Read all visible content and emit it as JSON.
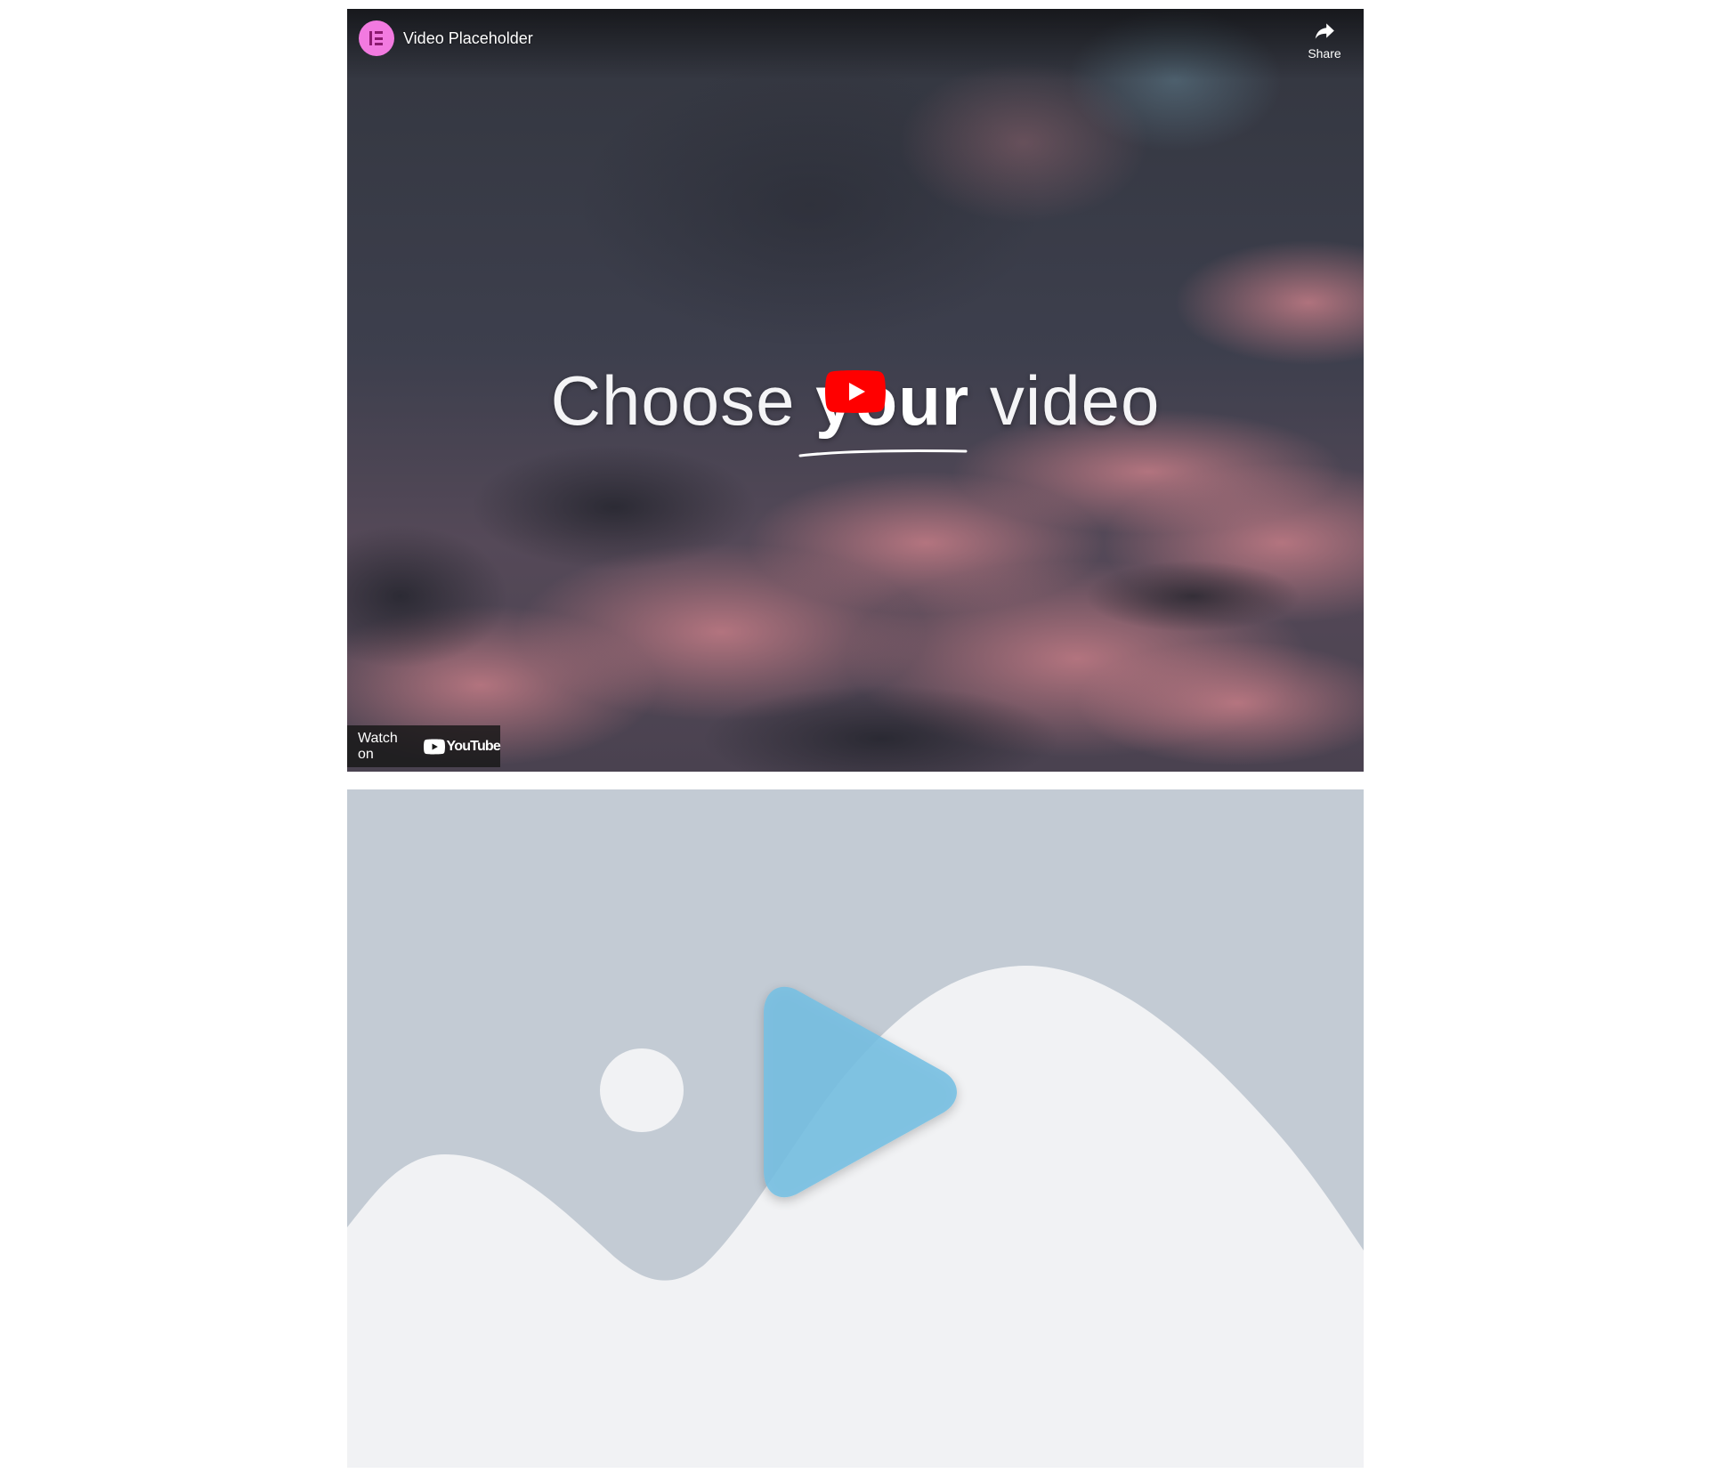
{
  "video": {
    "title": "Video Placeholder",
    "channel_icon": "elementor-logo-icon",
    "share_label": "Share",
    "headline_before": "Choose ",
    "headline_bold": "your",
    "headline_after": " video",
    "play_icon": "youtube-play-icon",
    "watch_on_label": "Watch on",
    "youtube_logo_text": "YouTube",
    "colors": {
      "avatar": "#f27ae0",
      "youtube_red": "#ff0000"
    }
  },
  "placeholder": {
    "play_icon": "play-triangle-icon",
    "sun_icon": "sun-circle-icon",
    "colors": {
      "sky": "#c3cbd4",
      "mountains": "#f1f2f4",
      "play": "#75bfe3"
    }
  }
}
